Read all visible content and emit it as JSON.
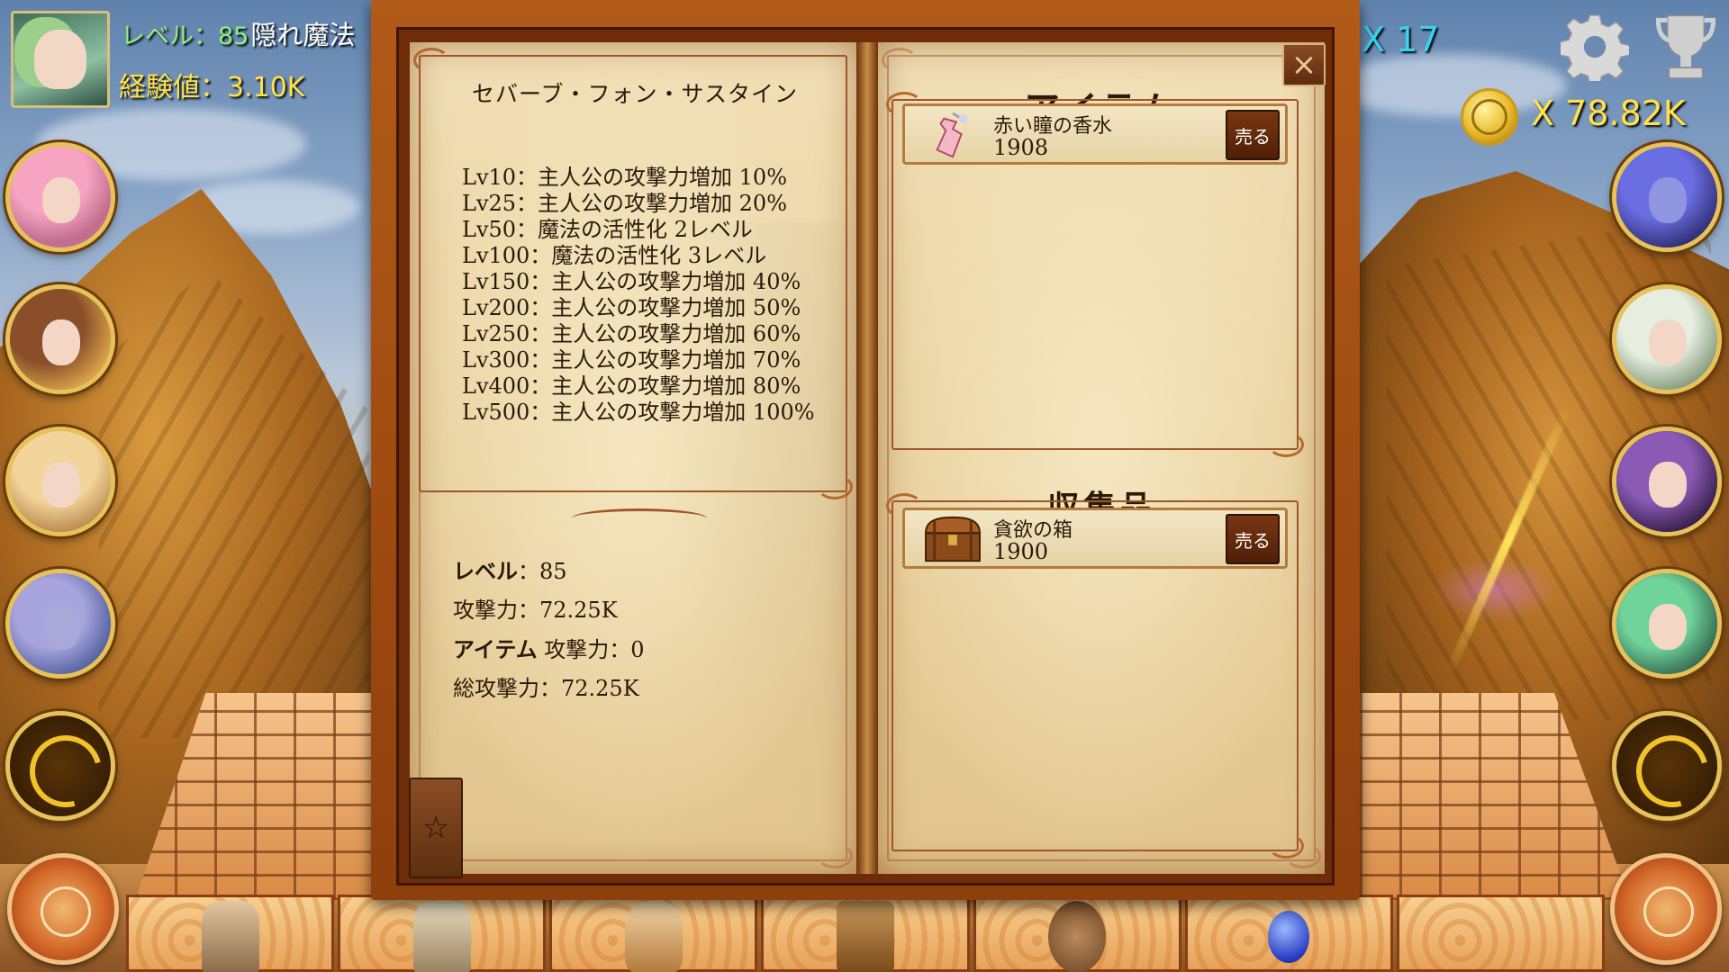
{
  "hud": {
    "level_label": "レベル：",
    "level_value": "85",
    "title": "隠れ魔法",
    "exp_label": "経験値：",
    "exp_value": "3.10K",
    "gem_count": "X 17",
    "coin_count": "X 78.82K"
  },
  "book": {
    "character_name": "セバーブ・フォン・サスタイン",
    "skills": [
      "Lv10：主人公の攻撃力増加 10%",
      "Lv25：主人公の攻撃力増加 20%",
      "Lv50：魔法の活性化 2レベル",
      "Lv100：魔法の活性化 3レベル",
      "Lv150：主人公の攻撃力増加 40%",
      "Lv200：主人公の攻撃力増加 50%",
      "Lv250：主人公の攻撃力増加 60%",
      "Lv300：主人公の攻撃力増加 70%",
      "Lv400：主人公の攻撃力増加 80%",
      "Lv500：主人公の攻撃力増加 100%"
    ],
    "stats": {
      "level_label": "レベル",
      "level_value": "：85",
      "attack_label": "攻撃力",
      "attack_value": "：72.25K",
      "item_label": "アイテム",
      "item_attack": "攻撃力：0",
      "total_label": "総攻撃力",
      "total_value": "：72.25K"
    },
    "star_tab": "☆",
    "close": "×",
    "items_title": "アイテム",
    "items": [
      {
        "name": "赤い瞳の香水",
        "value": "1908",
        "sell": "売る",
        "icon": "perfume-bottle"
      }
    ],
    "collection_title": "収集品",
    "collection": [
      {
        "name": "貪欲の箱",
        "value": "1900",
        "sell": "売る",
        "icon": "treasure-chest"
      }
    ]
  },
  "colors": {
    "exp": "#ffe14a",
    "level": "#8ef07a",
    "gem": "#38d3f0",
    "page": "#ecd7a8",
    "book_border": "#8f3f0c"
  }
}
